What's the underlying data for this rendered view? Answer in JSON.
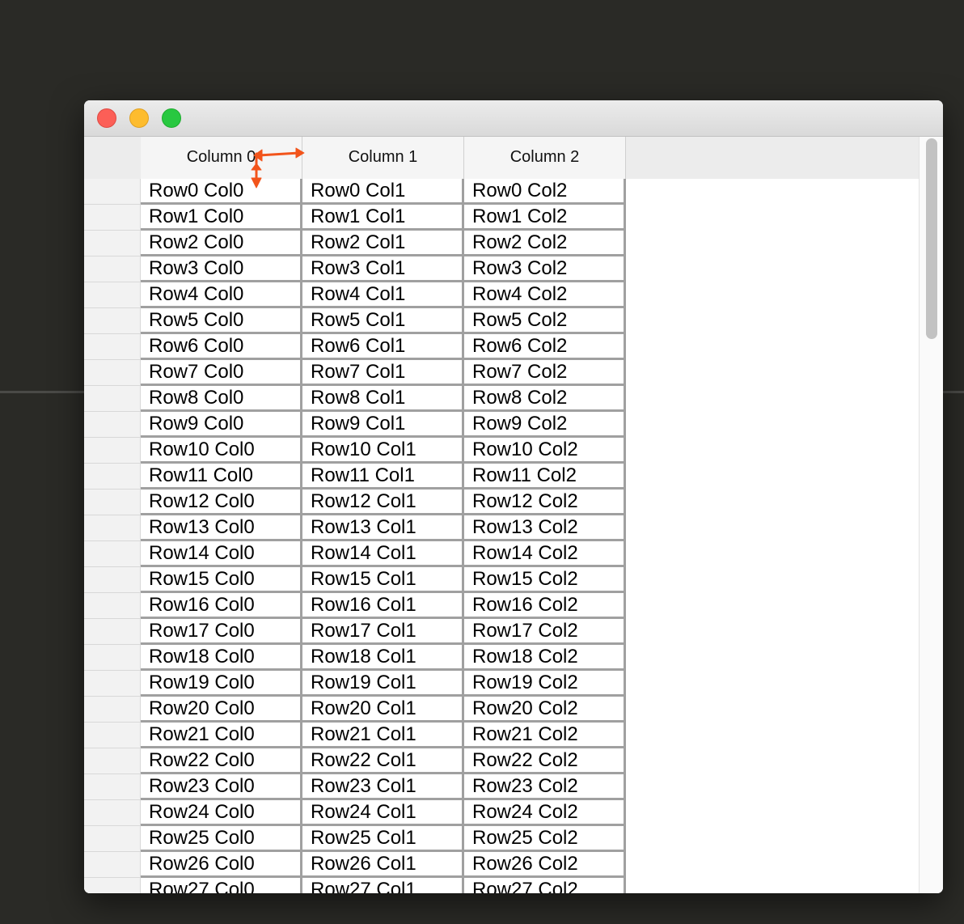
{
  "window": {
    "controls": {
      "close": "close",
      "minimize": "minimize",
      "zoom": "zoom"
    }
  },
  "table": {
    "columns": [
      "Column 0",
      "Column 1",
      "Column 2"
    ],
    "rows": [
      [
        "Row0 Col0",
        "Row0 Col1",
        "Row0 Col2"
      ],
      [
        "Row1 Col0",
        "Row1 Col1",
        "Row1 Col2"
      ],
      [
        "Row2 Col0",
        "Row2 Col1",
        "Row2 Col2"
      ],
      [
        "Row3 Col0",
        "Row3 Col1",
        "Row3 Col2"
      ],
      [
        "Row4 Col0",
        "Row4 Col1",
        "Row4 Col2"
      ],
      [
        "Row5 Col0",
        "Row5 Col1",
        "Row5 Col2"
      ],
      [
        "Row6 Col0",
        "Row6 Col1",
        "Row6 Col2"
      ],
      [
        "Row7 Col0",
        "Row7 Col1",
        "Row7 Col2"
      ],
      [
        "Row8 Col0",
        "Row8 Col1",
        "Row8 Col2"
      ],
      [
        "Row9 Col0",
        "Row9 Col1",
        "Row9 Col2"
      ],
      [
        "Row10 Col0",
        "Row10 Col1",
        "Row10 Col2"
      ],
      [
        "Row11 Col0",
        "Row11 Col1",
        "Row11 Col2"
      ],
      [
        "Row12 Col0",
        "Row12 Col1",
        "Row12 Col2"
      ],
      [
        "Row13 Col0",
        "Row13 Col1",
        "Row13 Col2"
      ],
      [
        "Row14 Col0",
        "Row14 Col1",
        "Row14 Col2"
      ],
      [
        "Row15 Col0",
        "Row15 Col1",
        "Row15 Col2"
      ],
      [
        "Row16 Col0",
        "Row16 Col1",
        "Row16 Col2"
      ],
      [
        "Row17 Col0",
        "Row17 Col1",
        "Row17 Col2"
      ],
      [
        "Row18 Col0",
        "Row18 Col1",
        "Row18 Col2"
      ],
      [
        "Row19 Col0",
        "Row19 Col1",
        "Row19 Col2"
      ],
      [
        "Row20 Col0",
        "Row20 Col1",
        "Row20 Col2"
      ],
      [
        "Row21 Col0",
        "Row21 Col1",
        "Row21 Col2"
      ],
      [
        "Row22 Col0",
        "Row22 Col1",
        "Row22 Col2"
      ],
      [
        "Row23 Col0",
        "Row23 Col1",
        "Row23 Col2"
      ],
      [
        "Row24 Col0",
        "Row24 Col1",
        "Row24 Col2"
      ],
      [
        "Row25 Col0",
        "Row25 Col1",
        "Row25 Col2"
      ],
      [
        "Row26 Col0",
        "Row26 Col1",
        "Row26 Col2"
      ],
      [
        "Row27 Col0",
        "Row27 Col1",
        "Row27 Col2"
      ]
    ]
  },
  "cursor": {
    "icon": "resize-cursor-icon",
    "color": "#f2541b"
  }
}
